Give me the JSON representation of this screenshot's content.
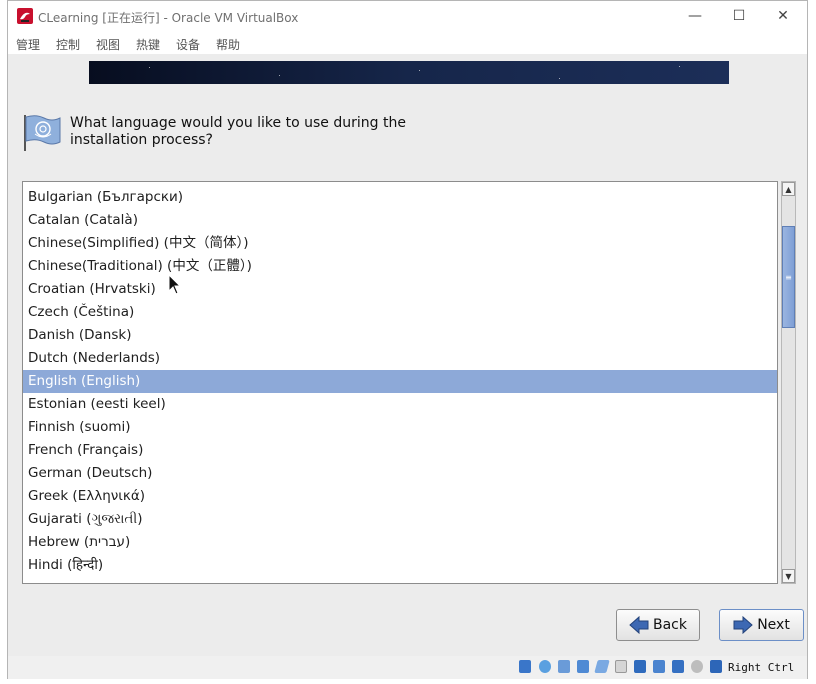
{
  "window": {
    "title": "CLearning [正在运行] - Oracle VM VirtualBox",
    "controls": {
      "minimize": "—",
      "maximize": "☐",
      "close": "✕"
    }
  },
  "menubar": {
    "items": [
      "管理",
      "控制",
      "视图",
      "热键",
      "设备",
      "帮助"
    ]
  },
  "installer": {
    "question": "What language would you like to use during the\ninstallation process?",
    "languages": [
      "Bulgarian (Български)",
      "Catalan (Català)",
      "Chinese(Simplified) (中文（简体）)",
      "Chinese(Traditional) (中文（正體）)",
      "Croatian (Hrvatski)",
      "Czech (Čeština)",
      "Danish (Dansk)",
      "Dutch (Nederlands)",
      "English (English)",
      "Estonian (eesti keel)",
      "Finnish (suomi)",
      "French (Français)",
      "German (Deutsch)",
      "Greek (Ελληνικά)",
      "Gujarati (ગુજરાતી)",
      "Hebrew (עברית)",
      "Hindi (हिन्दी)"
    ],
    "selected_language": "English (English)",
    "scroll_position_fraction": 0.12,
    "back_label": "Back",
    "next_label": "Next",
    "selection_color": "#8da9d8"
  },
  "statusbar": {
    "icons": [
      "hard-disk-icon",
      "optical-drive-icon",
      "audio-icon",
      "network-icon",
      "usb-icon",
      "shared-folders-icon",
      "display-icon",
      "video-capture-icon",
      "virtualization-icon",
      "mouse-integration-icon",
      "host-key-icon"
    ],
    "host_key": "Right Ctrl"
  }
}
